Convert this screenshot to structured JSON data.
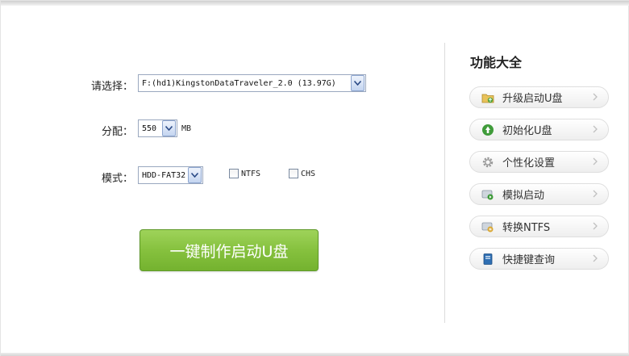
{
  "form": {
    "select_label": "请选择：",
    "drive_value": "F:(hd1)KingstonDataTraveler_2.0 (13.97G)",
    "alloc_label": "分配：",
    "alloc_value": "550",
    "alloc_unit": "MB",
    "mode_label": "模式：",
    "mode_value": "HDD-FAT32",
    "ntfs_label": "NTFS",
    "chs_label": "CHS",
    "make_button": "一键制作启动U盘"
  },
  "panel": {
    "title": "功能大全",
    "items": [
      {
        "label": "升级启动U盘",
        "icon": "folder-upgrade-icon"
      },
      {
        "label": "初始化U盘",
        "icon": "recycle-icon"
      },
      {
        "label": "个性化设置",
        "icon": "gear-icon"
      },
      {
        "label": "模拟启动",
        "icon": "disk-play-icon"
      },
      {
        "label": "转换NTFS",
        "icon": "disk-convert-icon"
      },
      {
        "label": "快捷键查询",
        "icon": "book-icon"
      }
    ]
  },
  "colors": {
    "make_button": "#86c13e",
    "accent_blue": "#9aa8bf"
  }
}
